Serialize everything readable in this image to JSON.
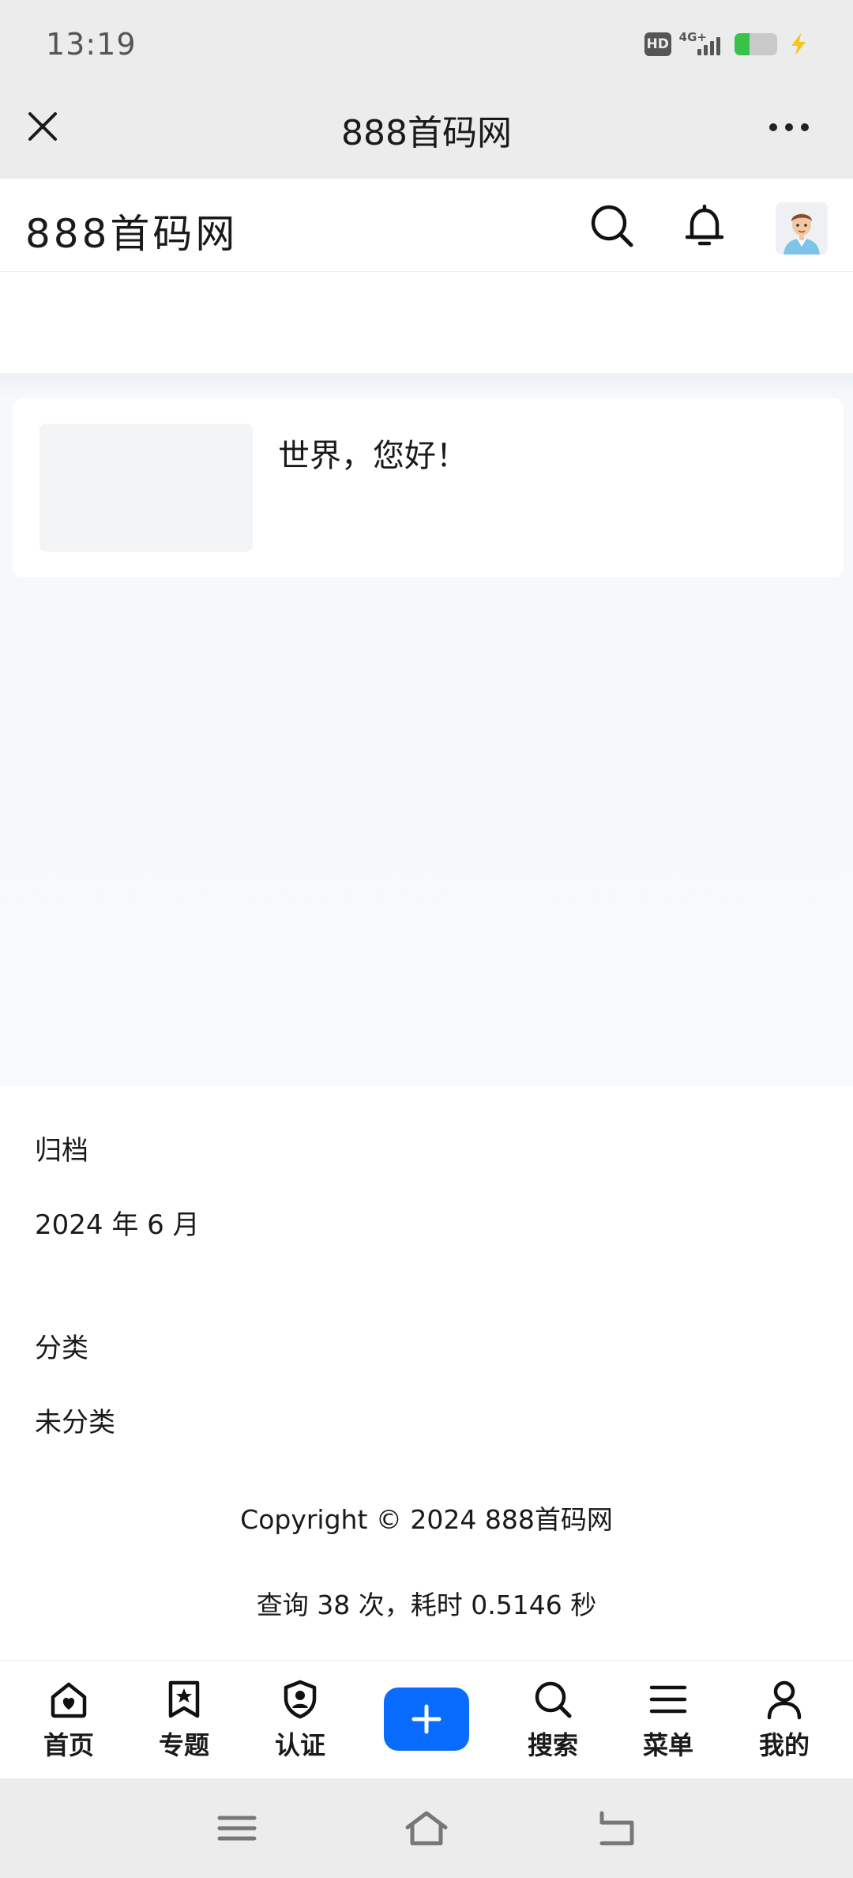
{
  "status_bar": {
    "time": "13:19",
    "hd": "HD",
    "network": "4G+",
    "battery_level": 0.35,
    "battery_color": "#37c24a",
    "charging": true
  },
  "title_bar": {
    "title": "888首码网",
    "close_icon": "close-icon",
    "more_icon": "more-icon"
  },
  "site_header": {
    "logo": "888首码网",
    "search_icon": "search-icon",
    "bell_icon": "bell-icon",
    "avatar_icon": "avatar-icon"
  },
  "posts": [
    {
      "title": "世界，您好！"
    }
  ],
  "archives": {
    "title": "归档",
    "items": [
      "2024 年 6 月"
    ]
  },
  "categories": {
    "title": "分类",
    "items": [
      "未分类"
    ]
  },
  "footer": {
    "copyright": "Copyright © 2024 888首码网",
    "query": "查询 38 次，耗时 0.5146 秒"
  },
  "tab_bar": {
    "accent": "#0a6cff",
    "tabs": [
      {
        "label": "首页",
        "icon": "home-heart-icon"
      },
      {
        "label": "专题",
        "icon": "bookmark-star-icon"
      },
      {
        "label": "认证",
        "icon": "shield-user-icon"
      },
      {
        "label": "",
        "icon": "plus-icon"
      },
      {
        "label": "搜索",
        "icon": "search-icon"
      },
      {
        "label": "菜单",
        "icon": "menu-icon"
      },
      {
        "label": "我的",
        "icon": "user-icon"
      }
    ]
  },
  "system_nav": {
    "icons": [
      "menu-icon",
      "home-icon",
      "back-icon"
    ]
  }
}
